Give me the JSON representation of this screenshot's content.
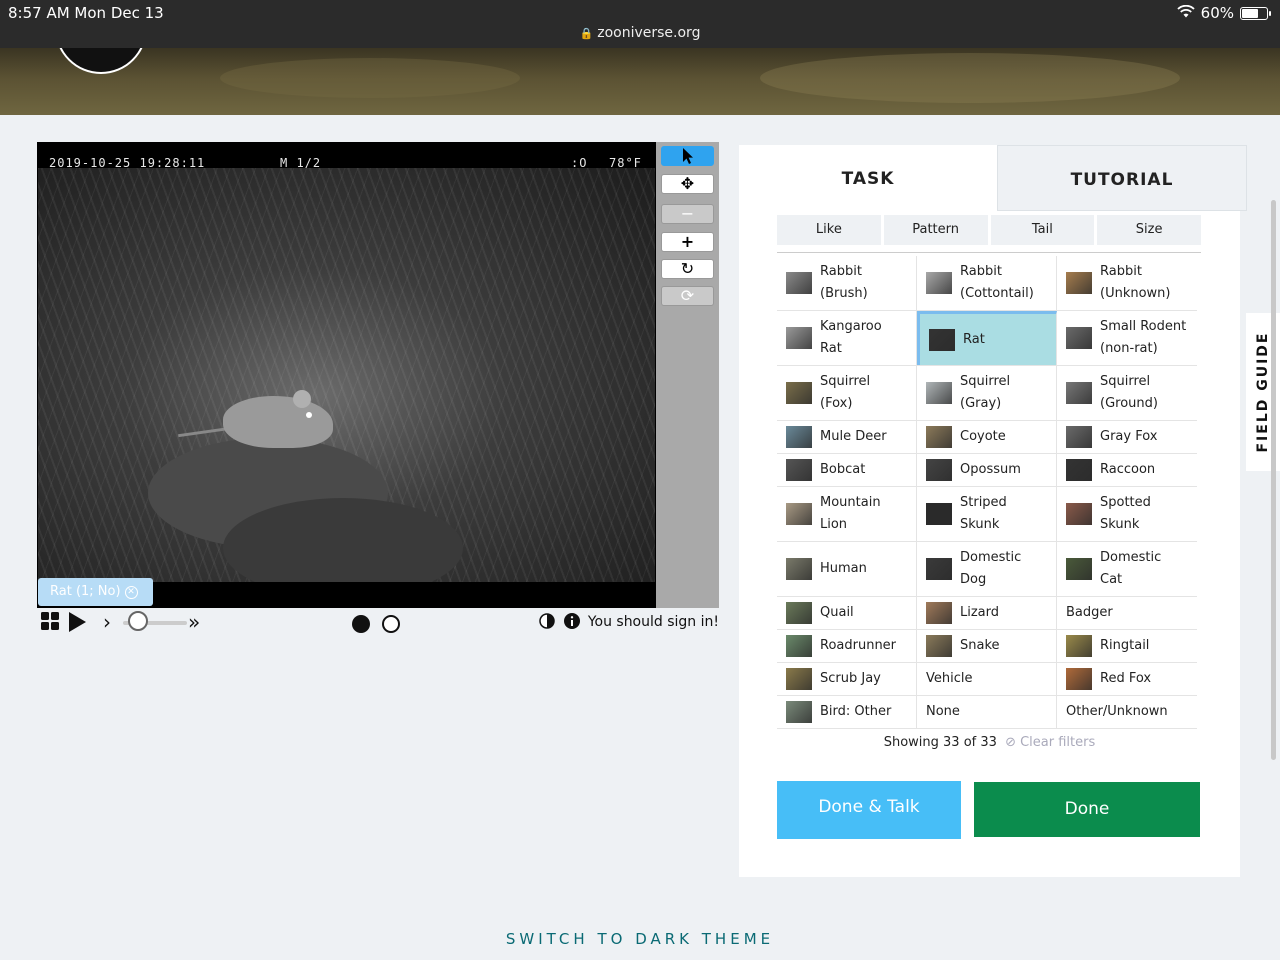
{
  "status": {
    "time": "8:57 AM   Mon Dec 13",
    "battery": "60%",
    "url": "zooniverse.org"
  },
  "viewer": {
    "timestamp": "2019-10-25 19:28:11",
    "mode": "M 1/2",
    "moon": ":O",
    "temp": "78°F",
    "tag_label": "Rat (1; No)",
    "signin": "You should sign in!"
  },
  "tabs": {
    "task": "TASK",
    "tutorial": "TUTORIAL"
  },
  "filters": [
    "Like",
    "Pattern",
    "Tail",
    "Size"
  ],
  "species": [
    [
      {
        "l1": "Rabbit",
        "l2": "(Brush)",
        "c": "#8a8a8a"
      },
      {
        "l1": "Rabbit",
        "l2": "(Cottontail)",
        "c": "#a8a8a8"
      },
      {
        "l1": "Rabbit",
        "l2": "(Unknown)",
        "c": "#a67d4e"
      }
    ],
    [
      {
        "l1": "Kangaroo",
        "l2": "Rat",
        "c": "#9a9a9a"
      },
      {
        "l1": "Rat",
        "l2": "",
        "c": "#333333",
        "selected": true
      },
      {
        "l1": "Small Rodent",
        "l2": "(non-rat)",
        "c": "#6a6a6a"
      }
    ],
    [
      {
        "l1": "Squirrel",
        "l2": "(Fox)",
        "c": "#7a6e4a"
      },
      {
        "l1": "Squirrel",
        "l2": "(Gray)",
        "c": "#b0b6b8"
      },
      {
        "l1": "Squirrel",
        "l2": "(Ground)",
        "c": "#777777"
      }
    ],
    [
      {
        "l1": "Mule Deer",
        "l2": "",
        "c": "#6a8a9a"
      },
      {
        "l1": "Coyote",
        "l2": "",
        "c": "#8c7a5a"
      },
      {
        "l1": "Gray Fox",
        "l2": "",
        "c": "#6a6a6a"
      }
    ],
    [
      {
        "l1": "Bobcat",
        "l2": "",
        "c": "#555555"
      },
      {
        "l1": "Opossum",
        "l2": "",
        "c": "#444444"
      },
      {
        "l1": "Raccoon",
        "l2": "",
        "c": "#333333"
      }
    ],
    [
      {
        "l1": "Mountain",
        "l2": "Lion",
        "c": "#a89a84"
      },
      {
        "l1": "Striped",
        "l2": "Skunk",
        "c": "#2a2a2a"
      },
      {
        "l1": "Spotted",
        "l2": "Skunk",
        "c": "#8a5a4a"
      }
    ],
    [
      {
        "l1": "Human",
        "l2": "",
        "c": "#7a7a6a"
      },
      {
        "l1": "Domestic",
        "l2": "Dog",
        "c": "#3a3a3a"
      },
      {
        "l1": "Domestic",
        "l2": "Cat",
        "c": "#4a5a3a"
      }
    ],
    [
      {
        "l1": "Quail",
        "l2": "",
        "c": "#6a7a5a"
      },
      {
        "l1": "Lizard",
        "l2": "",
        "c": "#a07a5a"
      },
      {
        "l1": "Badger",
        "l2": "",
        "c": ""
      }
    ],
    [
      {
        "l1": "Roadrunner",
        "l2": "",
        "c": "#6a8a6a"
      },
      {
        "l1": "Snake",
        "l2": "",
        "c": "#8a7a5a"
      },
      {
        "l1": "Ringtail",
        "l2": "",
        "c": "#9a8a4a"
      }
    ],
    [
      {
        "l1": "Scrub Jay",
        "l2": "",
        "c": "#8a7a4a"
      },
      {
        "l1": "Vehicle",
        "l2": "",
        "c": ""
      },
      {
        "l1": "Red Fox",
        "l2": "",
        "c": "#b06a3a"
      }
    ],
    [
      {
        "l1": "Bird: Other",
        "l2": "",
        "c": "#7a8a7a"
      },
      {
        "l1": "None",
        "l2": "",
        "c": ""
      },
      {
        "l1": "Other/Unknown",
        "l2": "",
        "c": ""
      }
    ]
  ],
  "showing": "Showing 33 of 33",
  "clear_filters": "Clear filters",
  "buttons": {
    "done_talk": "Done & Talk",
    "done": "Done"
  },
  "field_guide": "FIELD GUIDE",
  "dark_theme": "SWITCH TO DARK THEME",
  "colors": {
    "accent_blue": "#47bef7",
    "done_green": "#0b8c4d",
    "selected": "#aadde3",
    "link_teal": "#0a6a74"
  }
}
